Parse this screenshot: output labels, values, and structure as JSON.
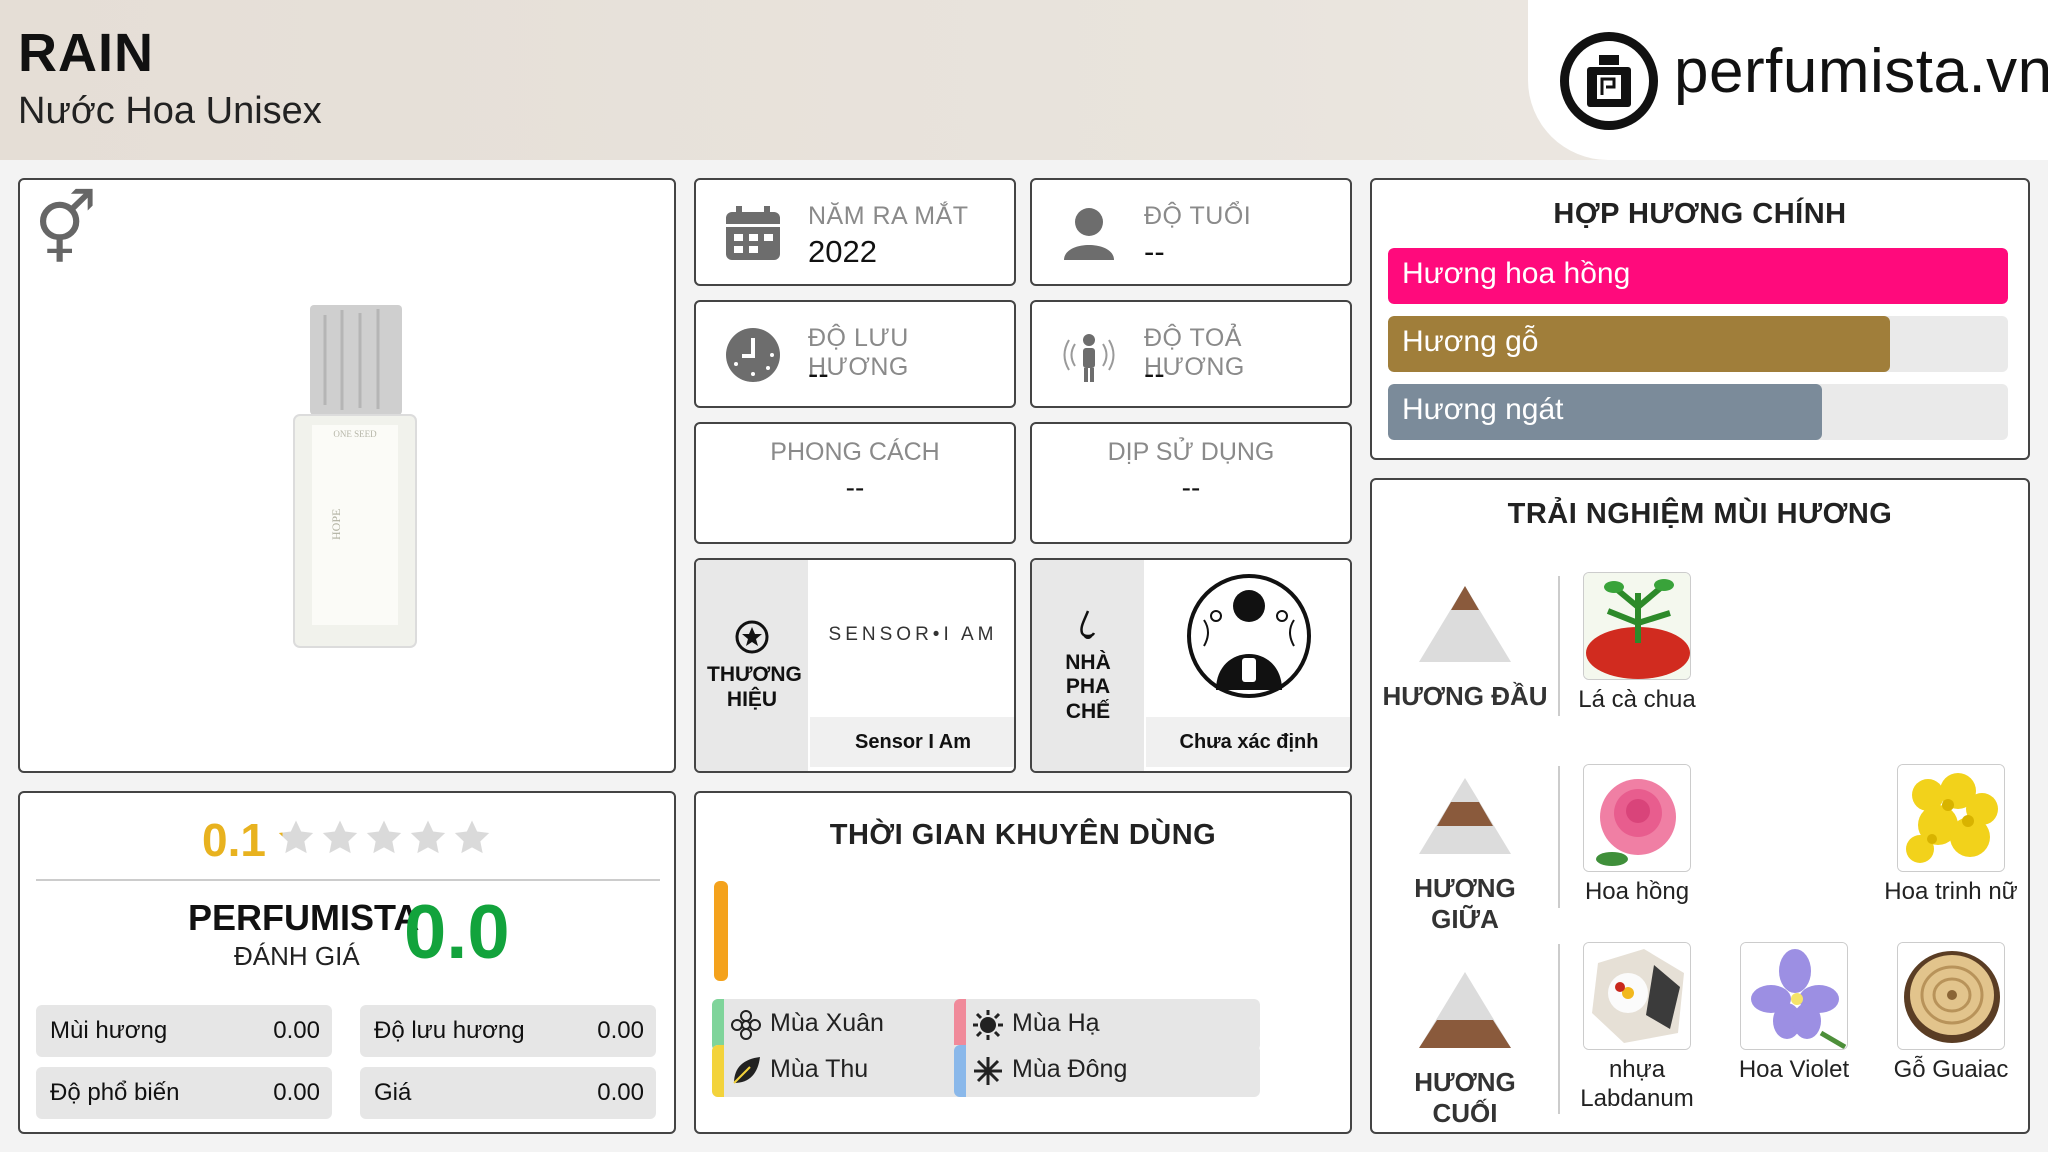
{
  "header": {
    "product_name": "RAIN",
    "product_sub": "Nước Hoa Unisex",
    "logo_text": "perfumista.vn"
  },
  "stats": {
    "launch_year": {
      "label": "NĂM RA MẮT",
      "value": "2022"
    },
    "age": {
      "label": "ĐỘ TUỔI",
      "value": "--"
    },
    "longevity": {
      "label": "ĐỘ LƯU HƯƠNG",
      "value": "--"
    },
    "sillage": {
      "label": "ĐỘ TOẢ HƯƠNG",
      "value": "--"
    },
    "style": {
      "label": "PHONG CÁCH",
      "value": "--"
    },
    "occasion": {
      "label": "DỊP SỬ DỤNG",
      "value": "--"
    }
  },
  "brand": {
    "label": "THƯƠNG HIỆU",
    "logo_text": "SENSOR•I AM",
    "name": "Sensor I Am"
  },
  "perfumer": {
    "label": "NHÀ PHA CHẾ",
    "name": "Chưa xác định"
  },
  "accords": {
    "title": "HỢP HƯƠNG CHÍNH",
    "items": [
      {
        "label": "Hương hoa hồng",
        "level": 1.0,
        "color": "#ff0a7c"
      },
      {
        "label": "Hương gỗ",
        "level": 0.81,
        "color": "#a07e3a"
      },
      {
        "label": "Hương ngát",
        "level": 0.7,
        "color": "#7b8b9a"
      }
    ]
  },
  "rating": {
    "user_score": "0.1",
    "stars": 0.02,
    "perfumista_label": "PERFUMISTA",
    "perfumista_sub": "ĐÁNH GIÁ",
    "perfumista_score": "0.0",
    "rows": [
      {
        "label": "Mùi hương",
        "value": "0.00"
      },
      {
        "label": "Độ lưu hương",
        "value": "0.00"
      },
      {
        "label": "Độ phổ biến",
        "value": "0.00"
      },
      {
        "label": "Giá",
        "value": "0.00"
      }
    ]
  },
  "time_of_use": {
    "title": "THỜI GIAN KHUYÊN DÙNG",
    "bar_level": 1.0,
    "seasons": [
      {
        "label": "Mùa Xuân",
        "color": "#7fd49a",
        "icon": "flower-icon"
      },
      {
        "label": "Mùa Hạ",
        "color": "#f08a9a",
        "icon": "sun-icon"
      },
      {
        "label": "Mùa Thu",
        "color": "#f3d33b",
        "icon": "leaf-icon"
      },
      {
        "label": "Mùa Đông",
        "color": "#8ab8ea",
        "icon": "snowflake-icon"
      }
    ]
  },
  "notes": {
    "title": "TRẢI NGHIỆM MÙI HƯƠNG",
    "top": {
      "label": "HƯƠNG ĐẦU",
      "items": [
        "Lá cà chua"
      ]
    },
    "middle": {
      "label": "HƯƠNG GIỮA",
      "items": [
        "Hoa hồng",
        "Hoa trinh nữ"
      ]
    },
    "base": {
      "label": "HƯƠNG CUỐI",
      "items": [
        "nhựa Labdanum",
        "Hoa Violet",
        "Gỗ Guaiac"
      ]
    }
  }
}
